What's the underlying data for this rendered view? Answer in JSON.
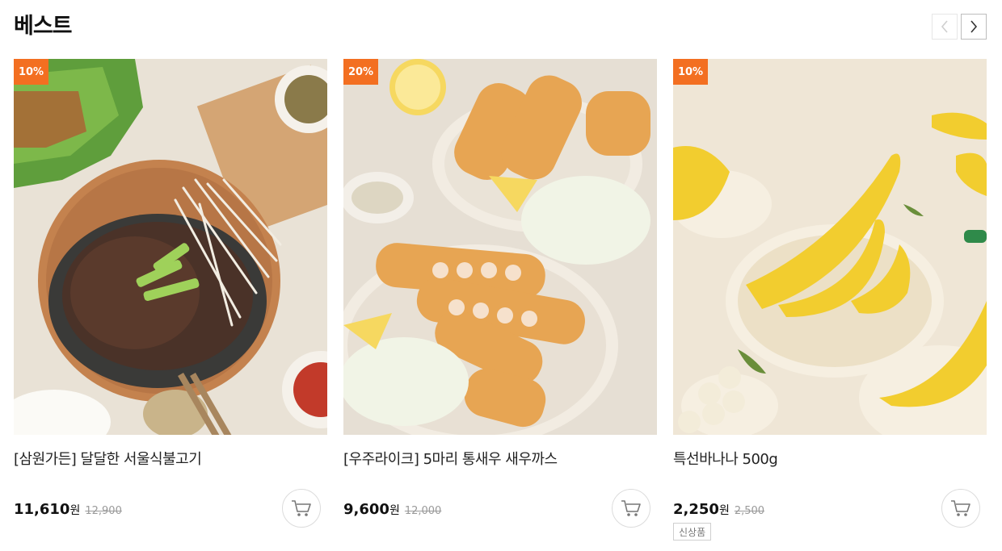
{
  "section": {
    "title": "베스트"
  },
  "nav": {
    "prev_icon": "chevron-left-icon",
    "next_icon": "chevron-right-icon"
  },
  "products": [
    {
      "discount": "10%",
      "name": "[삼원가든] 달달한 서울식불고기",
      "price": "11,610",
      "unit": "원",
      "original_price": "12,900",
      "cart_icon": "cart-icon"
    },
    {
      "discount": "20%",
      "name": "[우주라이크] 5마리 통새우 새우까스",
      "price": "9,600",
      "unit": "원",
      "original_price": "12,000",
      "cart_icon": "cart-icon"
    },
    {
      "discount": "10%",
      "name": "특선바나나 500g",
      "price": "2,250",
      "unit": "원",
      "original_price": "2,500",
      "tag": "신상품",
      "cart_icon": "cart-icon"
    }
  ],
  "colors": {
    "badge": "#f36f21",
    "text": "#111111",
    "muted": "#9a9a9a"
  }
}
